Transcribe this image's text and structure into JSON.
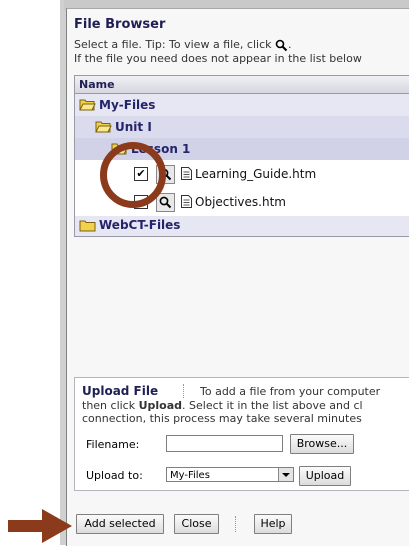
{
  "window": {
    "title": "File Browser",
    "subtitle_line1_before": "Select a file. Tip: To view a file, click",
    "subtitle_line1_after": ".",
    "subtitle_line2": "If the file you need does not appear in the list below"
  },
  "file_list": {
    "column_header": "Name",
    "folders": {
      "my_files": "My-Files",
      "unit": "Unit I",
      "lesson": "Lesson 1",
      "webct": "WebCT-Files"
    },
    "files": [
      {
        "name": "Learning_Guide.htm",
        "checked": true,
        "check_mark": "✔"
      },
      {
        "name": "Objectives.htm",
        "checked": false,
        "check_mark": ""
      }
    ]
  },
  "upload": {
    "title": "Upload File",
    "line1": "To add a file from your computer",
    "line2_before": "then click ",
    "line2_bold": "Upload",
    "line2_after": ". Select it in the list above and cl",
    "line3": "connection, this process may take several minutes",
    "filename_label": "Filename:",
    "filename_value": "",
    "browse_label": "Browse...",
    "upload_to_label": "Upload to:",
    "upload_to_value": "My-Files",
    "upload_button": "Upload"
  },
  "actions": {
    "add_selected": "Add selected",
    "close": "Close",
    "help": "Help"
  },
  "colors": {
    "accent_text": "#1f1f55",
    "annotation": "#8b3a1b",
    "folder": "#f2d24a"
  }
}
